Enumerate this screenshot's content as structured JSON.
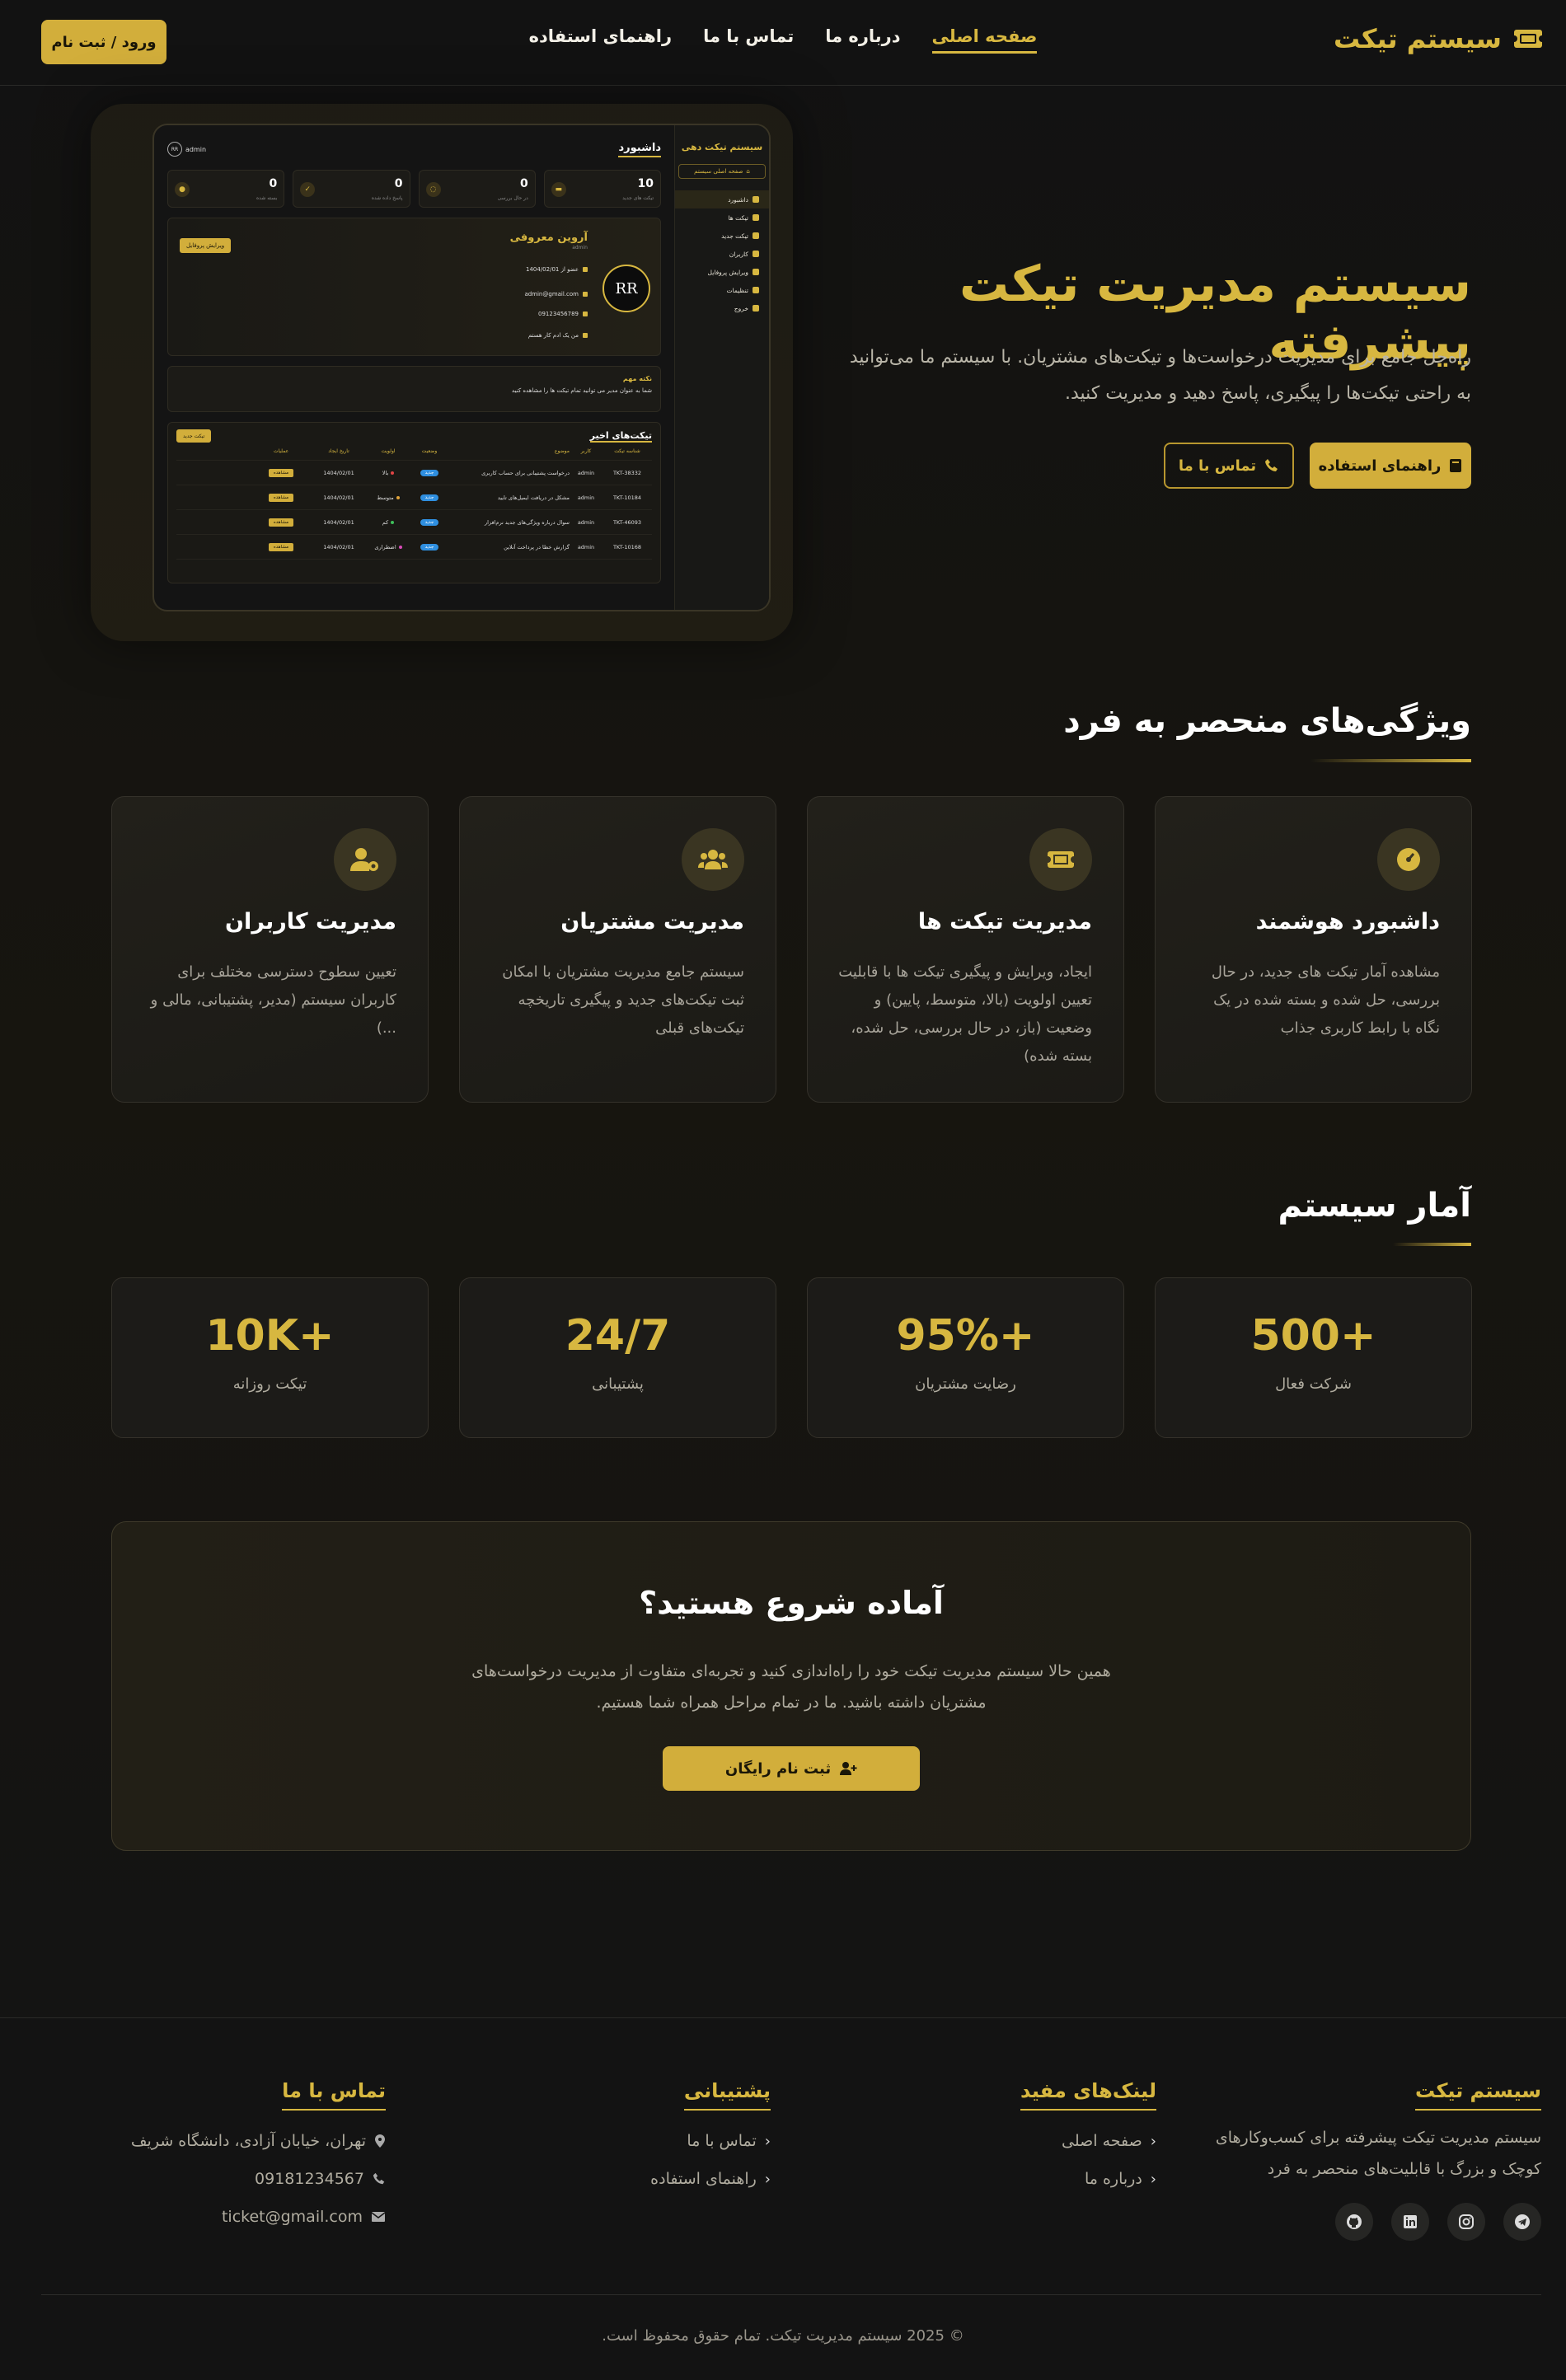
{
  "header": {
    "logo_text": "سیستم تیکت",
    "logo_icon": "ticket-icon",
    "nav": [
      "صفحه اصلی",
      "درباره ما",
      "تماس با ما",
      "راهنمای استفاده"
    ],
    "login_button": "ورود / ثبت نام"
  },
  "mockup": {
    "brand": "سیستم تیکت دهی",
    "home_link": "صفحه اصلی سیستم",
    "menu": [
      "داشبورد",
      "تیکت ها",
      "تیکت جدید",
      "کاربران",
      "ویرایش پروفایل",
      "تنظیمات",
      "خروج"
    ],
    "title": "داشبورد",
    "user": "admin",
    "avatar_text": "RR",
    "stats": [
      {
        "value": "10",
        "label": "تیکت های جدید"
      },
      {
        "value": "0",
        "label": "در حال بررسی"
      },
      {
        "value": "0",
        "label": "پاسخ داده شده"
      },
      {
        "value": "0",
        "label": "بسته شده"
      }
    ],
    "profile": {
      "name": "آروین معروفی",
      "role": "admin",
      "logo_text": "RR",
      "member_since": "عضو از 1404/02/01",
      "email": "admin@gmail.com",
      "phone": "09123456789",
      "bio": "من یک ادم کار هستم",
      "edit_button": "ویرایش پروفایل"
    },
    "note": {
      "title": "نکته مهم",
      "body": "شما به عنوان مدیر می توانید تمام تیکت ها را مشاهده کنید"
    },
    "table": {
      "title": "تیکت‌های اخیر",
      "new_button": "تیکت جدید",
      "headers": [
        "شناسه تیکت",
        "کاربر",
        "موضوع",
        "وضعیت",
        "اولویت",
        "تاریخ ایجاد",
        "عملیات"
      ],
      "rows": [
        {
          "id": "TKT-38332",
          "user": "admin",
          "subject": "درخواست پشتیبانی برای حساب کاربری",
          "status": "جدید",
          "priority": "بالا",
          "priority_color": "#e04545",
          "date": "1404/02/01",
          "action": "مشاهده"
        },
        {
          "id": "TKT-10184",
          "user": "admin",
          "subject": "مشکل در دریافت ایمیل‌های تایید",
          "status": "جدید",
          "priority": "متوسط",
          "priority_color": "#e0a33a",
          "date": "1404/02/01",
          "action": "مشاهده"
        },
        {
          "id": "TKT-46093",
          "user": "admin",
          "subject": "سوال درباره ویژگی‌های جدید نرم‌افزار",
          "status": "جدید",
          "priority": "کم",
          "priority_color": "#3fbf5a",
          "date": "1404/02/01",
          "action": "مشاهده"
        },
        {
          "id": "TKT-10168",
          "user": "admin",
          "subject": "گزارش خطا در پرداخت آنلاین",
          "status": "جدید",
          "priority": "اضطراری",
          "priority_color": "#d84bb8",
          "date": "1404/02/01",
          "action": "مشاهده"
        }
      ]
    }
  },
  "hero": {
    "title": "سیستم مدیریت تیکت پیشرفته",
    "description": "راه‌حل جامع برای مدیریت درخواست‌ها و تیکت‌های مشتریان. با سیستم ما می‌توانید به راحتی تیکت‌ها را پیگیری، پاسخ دهید و مدیریت کنید.",
    "guide_button": "راهنمای استفاده",
    "contact_button": "تماس با ما"
  },
  "features": {
    "title": "ویژگی‌های منحصر به فرد",
    "items": [
      {
        "icon": "dashboard-gauge-icon",
        "title": "داشبورد هوشمند",
        "desc": "مشاهده آمار تیکت های جدید، در حال بررسی، حل شده و بسته شده در یک نگاه با رابط کاربری جذاب"
      },
      {
        "icon": "ticket-icon",
        "title": "مدیریت تیکت ها",
        "desc": "ایجاد، ویرایش و پیگیری تیکت ها با قابلیت تعیین اولویت (بالا، متوسط، پایین) و وضعیت (باز، در حال بررسی، حل شده، بسته شده)"
      },
      {
        "icon": "users-icon",
        "title": "مدیریت مشتریان",
        "desc": "سیستم جامع مدیریت مشتریان با امکان ثبت تیکت‌های جدید و پیگیری تاریخچه تیکت‌های قبلی"
      },
      {
        "icon": "user-cog-icon",
        "title": "مدیریت کاربران",
        "desc": "تعیین سطوح دسترسی مختلف برای کاربران سیستم (مدیر، پشتیبانی، مالی و ...)"
      }
    ]
  },
  "stats": {
    "title": "آمار سیستم",
    "items": [
      {
        "value": "500+",
        "label": "شرکت فعال"
      },
      {
        "value": "95%+",
        "label": "رضایت مشتریان"
      },
      {
        "value": "24/7",
        "label": "پشتیبانی"
      },
      {
        "value": "10K+",
        "label": "تیکت روزانه"
      }
    ]
  },
  "cta": {
    "title": "آماده شروع هستید؟",
    "description": "همین حالا سیستم مدیریت تیکت خود را راه‌اندازی کنید و تجربه‌ای متفاوت از مدیریت درخواست‌های مشتریان داشته باشید. ما در تمام مراحل همراه شما هستیم.",
    "button": "ثبت نام رایگان"
  },
  "footer": {
    "about": {
      "title": "سیستم تیکت",
      "text": "سیستم مدیریت تیکت پیشرفته برای کسب‌وکارهای کوچک و بزرگ با قابلیت‌های منحصر به فرد"
    },
    "links": {
      "title": "لینک‌های مفید",
      "items": [
        "صفحه اصلی",
        "درباره ما"
      ]
    },
    "support": {
      "title": "پشتیبانی",
      "items": [
        "تماس با ما",
        "راهنمای استفاده"
      ]
    },
    "contact": {
      "title": "تماس با ما",
      "address": "تهران، خیابان آزادی، دانشگاه شریف",
      "phone": "09181234567",
      "email": "ticket@gmail.com"
    },
    "social": [
      "telegram-icon",
      "instagram-icon",
      "linkedin-icon",
      "github-icon"
    ],
    "copyright": "© 2025 سیستم مدیریت تیکت. تمام حقوق محفوظ است."
  }
}
